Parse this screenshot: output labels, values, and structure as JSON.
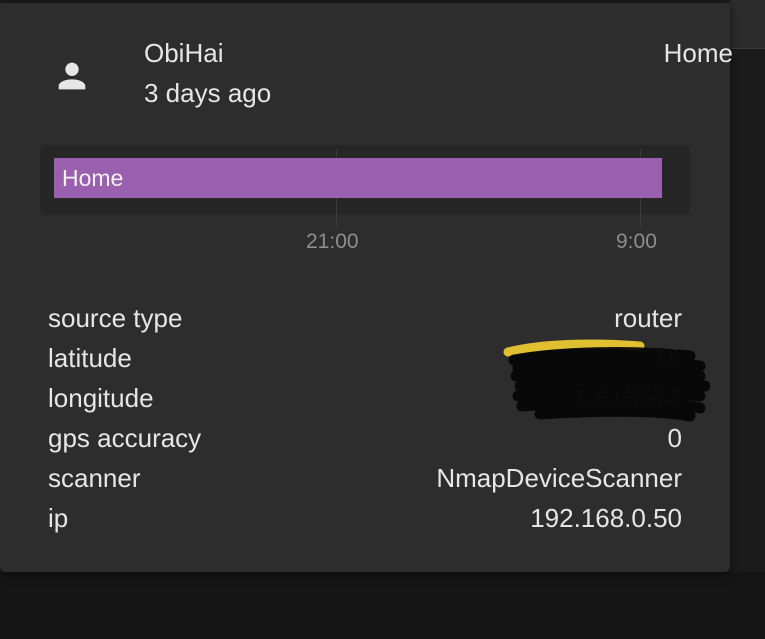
{
  "entity": {
    "name": "ObiHai",
    "last_changed": "3 days ago",
    "state": "Home",
    "icon": "person-icon"
  },
  "timeline": {
    "bar_label": "Home",
    "bar_color": "#9b5fb0",
    "ticks": [
      "21:00",
      "9:00"
    ]
  },
  "attributes": [
    {
      "key": "source type",
      "value": "router"
    },
    {
      "key": "latitude",
      "value": "16"
    },
    {
      "key": "longitude",
      "value": "-1.515574"
    },
    {
      "key": "gps accuracy",
      "value": "0"
    },
    {
      "key": "scanner",
      "value": "NmapDeviceScanner"
    },
    {
      "key": "ip",
      "value": "192.168.0.50"
    }
  ]
}
